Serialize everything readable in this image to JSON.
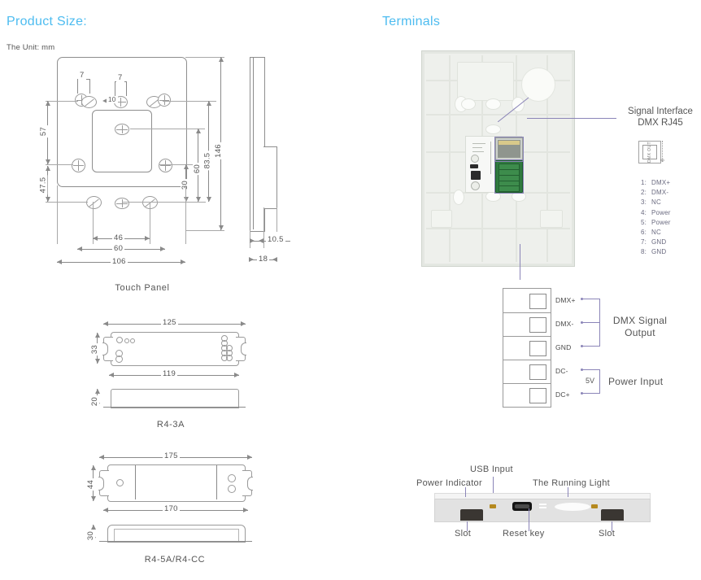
{
  "sections": {
    "left_heading": "Product Size:",
    "unit_note": "The Unit: mm",
    "right_heading": "Terminals"
  },
  "touch_panel": {
    "caption": "Touch Panel",
    "dimensions": {
      "height_overall": "146",
      "height_83_5": "83.5",
      "height_60": "60",
      "height_30": "30",
      "height_57": "57",
      "height_47_5": "47.5",
      "width_overall": "106",
      "width_60": "60",
      "width_46": "46",
      "hole_7_left": "7",
      "hole_7_right": "7",
      "hole_10": "10",
      "side_depth": "18",
      "side_plate": "10.5"
    }
  },
  "r4_3a": {
    "caption": "R4-3A",
    "dimensions": {
      "length_outer": "125",
      "length_inner": "119",
      "width": "33",
      "height": "20"
    }
  },
  "r4_5a": {
    "caption": "R4-5A/R4-CC",
    "dimensions": {
      "length_outer": "175",
      "length_inner": "170",
      "width": "44",
      "height": "30"
    }
  },
  "signal_interface": {
    "title_line1": "Signal Interface",
    "title_line2": "DMX  RJ45",
    "icon_text": "DMX OUT",
    "icon_pin_count": "8",
    "pins": [
      {
        "n": "1:",
        "label": "DMX+"
      },
      {
        "n": "2:",
        "label": "DMX-"
      },
      {
        "n": "3:",
        "label": "NC"
      },
      {
        "n": "4:",
        "label": "Power"
      },
      {
        "n": "5:",
        "label": "Power"
      },
      {
        "n": "6:",
        "label": "NC"
      },
      {
        "n": "7:",
        "label": "GND"
      },
      {
        "n": "8:",
        "label": "GND"
      }
    ]
  },
  "terminal_block": {
    "rows": [
      {
        "label": "DMX+"
      },
      {
        "label": "DMX-"
      },
      {
        "label": "GND"
      },
      {
        "label": "DC-"
      },
      {
        "label": "DC+"
      }
    ],
    "group_signal": "DMX Signal\nOutput",
    "group_signal_l1": "DMX Signal",
    "group_signal_l2": "Output",
    "group_power": "Power Input",
    "voltage": "5V"
  },
  "edge_view": {
    "labels": {
      "usb_input": "USB Input",
      "power_indicator": "Power Indicator",
      "running_light": "The Running Light",
      "slot_left": "Slot",
      "reset_key": "Reset key",
      "slot_right": "Slot"
    }
  },
  "colors": {
    "heading_blue": "#4dbcf0",
    "leader_purple": "#8b85b8",
    "line_gray": "#8a8a8a",
    "terminal_green": "#2f7a3e",
    "led_amber": "#b5891f"
  }
}
